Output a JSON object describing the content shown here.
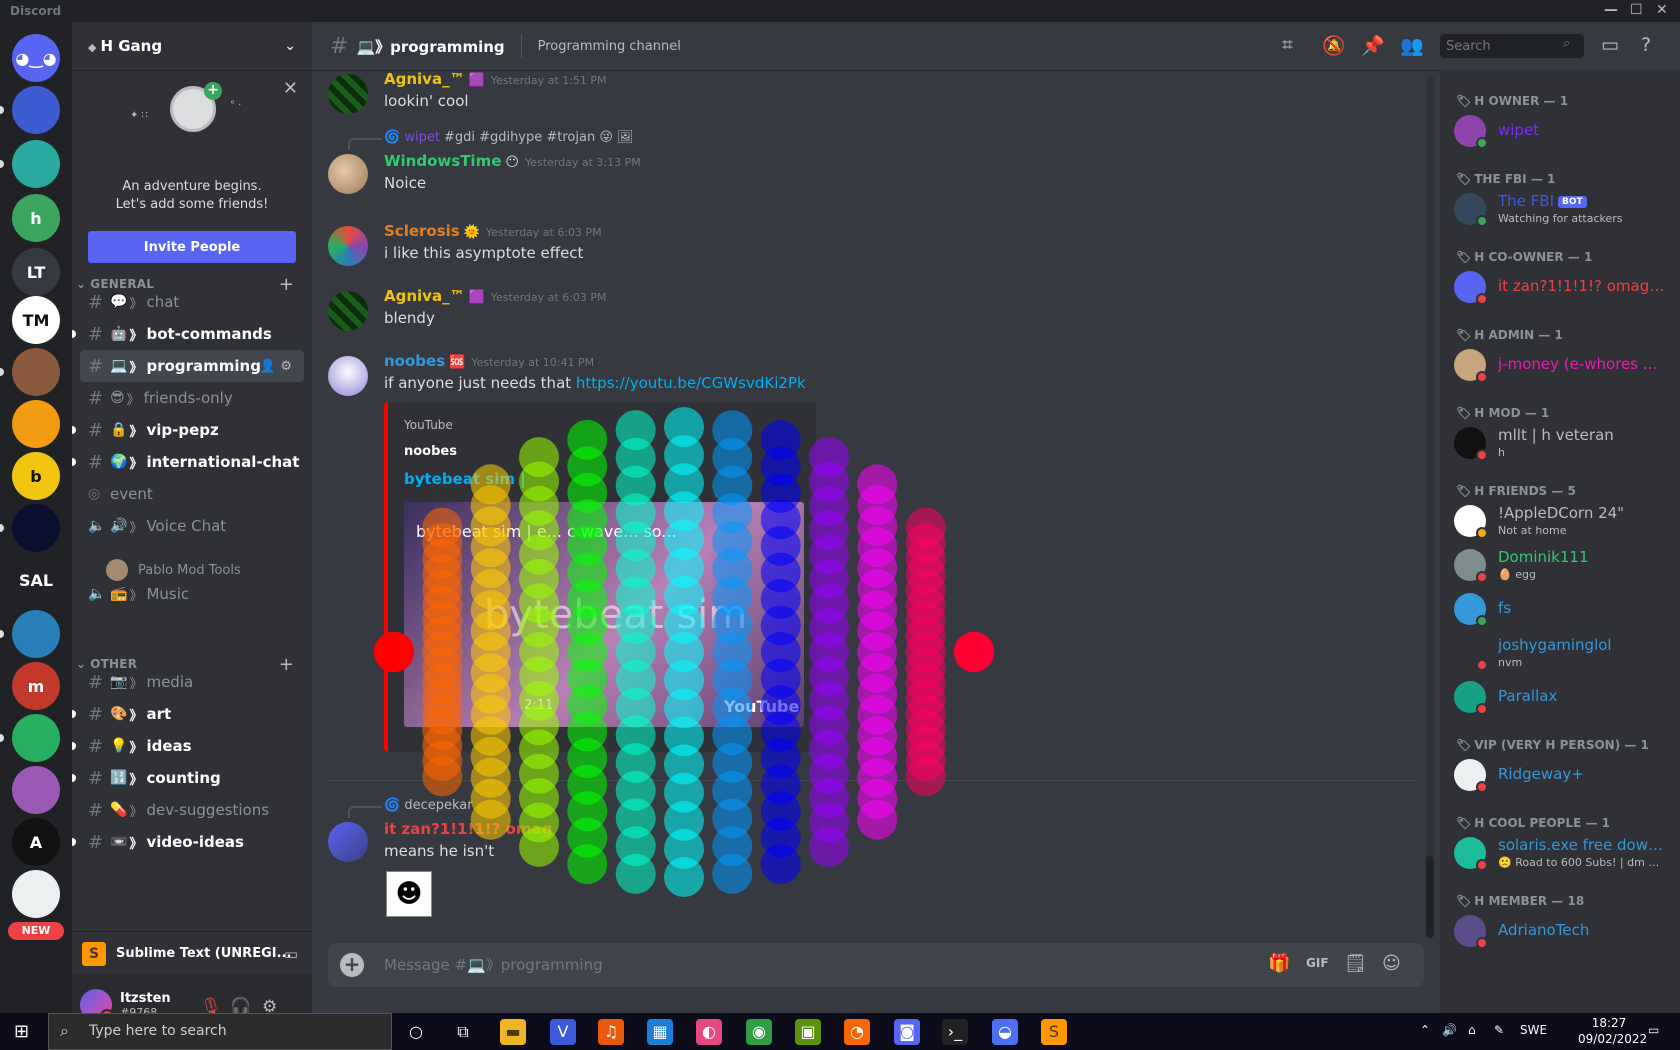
{
  "app": {
    "title": "Discord"
  },
  "server": {
    "name": "H Gang"
  },
  "invite_card": {
    "line1": "An adventure begins.",
    "line2": "Let's add some friends!",
    "button": "Invite People"
  },
  "categories": {
    "general": "GENERAL",
    "other": "OTHER"
  },
  "channels_general": [
    {
      "name": "chat",
      "emoji": "💬",
      "unread": false
    },
    {
      "name": "bot-commands",
      "emoji": "🤖",
      "unread": true
    },
    {
      "name": "programming",
      "emoji": "💻",
      "unread": false,
      "active": true
    },
    {
      "name": "friends-only",
      "emoji": "😎",
      "unread": false
    },
    {
      "name": "vip-pepz",
      "emoji": "🔒",
      "unread": true
    },
    {
      "name": "international-chat",
      "emoji": "🌍",
      "unread": true
    },
    {
      "name": "event",
      "emoji": "",
      "unread": false
    },
    {
      "name": "Voice Chat",
      "emoji": "🔊",
      "unread": false
    },
    {
      "name": "Music",
      "emoji": "📻",
      "unread": false
    }
  ],
  "voice_users": [
    "Pablo Mod Tools"
  ],
  "channels_other": [
    {
      "name": "media",
      "emoji": "📷",
      "unread": false
    },
    {
      "name": "art",
      "emoji": "🎨",
      "unread": true
    },
    {
      "name": "ideas",
      "emoji": "💡",
      "unread": true
    },
    {
      "name": "counting",
      "emoji": "🔢",
      "unread": true
    },
    {
      "name": "dev-suggestions",
      "emoji": "💊",
      "unread": false
    },
    {
      "name": "video-ideas",
      "emoji": "📼",
      "unread": true
    }
  ],
  "activity": {
    "label": "Sublime Text (UNREGI..."
  },
  "user": {
    "name": "Itzsten",
    "tag": "#9768"
  },
  "topbar": {
    "channel": "💻》programming",
    "topic": "Programming channel",
    "search_placeholder": "Search"
  },
  "messages": [
    {
      "author": "Agniva_™",
      "color": "#f1c40f",
      "badge": "",
      "time": "Yesterday at 1:51 PM",
      "text": "lookin' cool"
    },
    {
      "reply_user": "wipet",
      "reply_text": "#gdi #gdihype #trojan 😜 🖼",
      "author": "WindowsTime",
      "color": "#2ecc71",
      "badge": "😶",
      "time": "Yesterday at 3:13 PM",
      "text": "Noice"
    },
    {
      "author": "Sclerosis",
      "color": "#e67e22",
      "badge": "🌞",
      "time": "Yesterday at 6:03 PM",
      "text": "i like this asymptote effect"
    },
    {
      "author": "Agniva_™",
      "color": "#f1c40f",
      "badge": "",
      "time": "Yesterday at 6:03 PM",
      "text": "blendy"
    },
    {
      "author": "noobes",
      "color": "#3498db",
      "badge": "🆘",
      "time": "Yesterday at 10:41 PM",
      "text": "if anyone just needs that ",
      "link": "https://youtu.be/CGWsvdKi2Pk"
    },
    {
      "reply_user": "decepekar",
      "reply_text": "",
      "author": "it zan?1!1!1!? omag",
      "color": "#ed4245",
      "badge": "",
      "time": "",
      "text": "means he isn't"
    }
  ],
  "embed": {
    "provider": "YouTube",
    "author": "noobes",
    "title": "bytebeat sim |",
    "video_caption": "bytebeat sim | e... c wave... so...",
    "overlay_text": "bytebeat sim",
    "duration": "2:11",
    "brand": "YouTube"
  },
  "composer": {
    "placeholder": "Message #💻》programming"
  },
  "members": [
    {
      "header": "H OWNER — 1",
      "users": [
        {
          "name": "wipet",
          "color": "#7b2ff7",
          "status": "",
          "online": "online"
        }
      ]
    },
    {
      "header": "THE FBI — 1",
      "users": [
        {
          "name": "The FBI",
          "color": "#3b5bdb",
          "status": "Watching for attackers",
          "online": "mobile",
          "bot": "BOT"
        }
      ]
    },
    {
      "header": "H CO-OWNER — 1",
      "users": [
        {
          "name": "it zan?1!1!1!? omagaz!?11",
          "color": "#ed4245",
          "status": "",
          "online": "dnd"
        }
      ]
    },
    {
      "header": "H ADMIN — 1",
      "users": [
        {
          "name": "j-money (e-whores ...",
          "color": "#e91eb3",
          "status": "",
          "online": "dnd"
        }
      ]
    },
    {
      "header": "H MOD — 1",
      "users": [
        {
          "name": "mllt | h veteran",
          "color": "#b9bbbe",
          "status": "h",
          "online": "dnd"
        }
      ]
    },
    {
      "header": "H FRIENDS — 5",
      "users": [
        {
          "name": "!AppleDCorn 24\"",
          "color": "#b9bbbe",
          "status": "Not at home",
          "online": "idle"
        },
        {
          "name": "Dominik111",
          "color": "#2ecc71",
          "status": "🥚 egg",
          "online": "dnd"
        },
        {
          "name": "fs",
          "color": "#3498db",
          "status": "",
          "online": "mobile"
        },
        {
          "name": "joshygaminglol",
          "color": "#3498db",
          "status": "nvm",
          "online": "dnd"
        },
        {
          "name": "Parallax",
          "color": "#3498db",
          "status": "",
          "online": "dnd"
        }
      ]
    },
    {
      "header": "VIP (VERY H PERSON) — 1",
      "users": [
        {
          "name": "Ridgeway+",
          "color": "#3498db",
          "status": "",
          "online": "dnd"
        }
      ]
    },
    {
      "header": "H COOL PEOPLE — 1",
      "users": [
        {
          "name": "solaris.exe free downl...",
          "color": "#3498db",
          "status": "🙁 Road to 600 Subs! | dm me...",
          "online": "dnd"
        }
      ]
    },
    {
      "header": "H MEMBER — 18",
      "users": [
        {
          "name": "AdrianoTech",
          "color": "#3498db",
          "status": "",
          "online": "dnd"
        }
      ]
    }
  ],
  "taskbar": {
    "search_placeholder": "Type here to search",
    "lang": "SWE",
    "time": "18:27",
    "date": "09/02/2022"
  },
  "guilds": [
    {
      "label": "",
      "bg": "#5865f2",
      "icon": "discord-home-icon"
    },
    {
      "label": "",
      "bg": "#3d5bd1"
    },
    {
      "label": "",
      "bg": "#2aa9a0"
    },
    {
      "label": "h",
      "bg": "#3ba55d"
    },
    {
      "label": "LT",
      "bg": "#36393f"
    },
    {
      "label": "TM",
      "bg": "#ffffff"
    },
    {
      "label": "",
      "bg": "#8a5a3c"
    },
    {
      "label": "",
      "bg": "#f39c12"
    },
    {
      "label": "b",
      "bg": "#f1c40f"
    },
    {
      "label": "",
      "bg": "#0b0f2e"
    },
    {
      "label": "SAL",
      "bg": "#202225"
    },
    {
      "label": "",
      "bg": "#2980b9"
    },
    {
      "label": "m",
      "bg": "#c0392b"
    },
    {
      "label": "",
      "bg": "#27ae60"
    },
    {
      "label": "",
      "bg": "#9b59b6"
    },
    {
      "label": "A",
      "bg": "#111111"
    },
    {
      "label": "",
      "bg": "#ecf0f1"
    }
  ],
  "new_badge": "NEW"
}
